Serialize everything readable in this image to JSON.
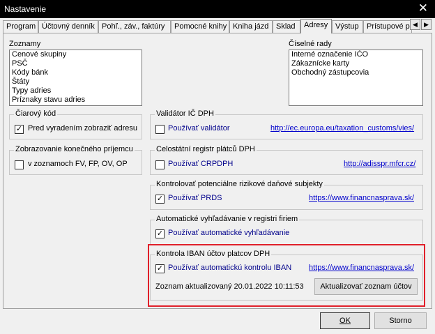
{
  "window": {
    "title": "Nastavenie",
    "close_glyph": "✕"
  },
  "tabs": [
    {
      "label": "Program"
    },
    {
      "label": "Účtovný denník"
    },
    {
      "label": "Pohľ., záv., faktúry"
    },
    {
      "label": "Pomocné knihy"
    },
    {
      "label": "Kniha jázd"
    },
    {
      "label": "Sklad"
    },
    {
      "label": "Adresy",
      "active": true
    },
    {
      "label": "Výstup"
    },
    {
      "label": "Prístupové pr"
    }
  ],
  "tab_arrows": {
    "left": "◀",
    "right": "▶"
  },
  "zoznamy": {
    "label": "Zoznamy",
    "items": [
      "Cenové skupiny",
      "PSČ",
      "Kódy bánk",
      "Štáty",
      "Typy adries",
      "Príznaky stavu adries"
    ]
  },
  "ciselne_rady": {
    "label": "Číselné rady",
    "items": [
      "Interné označenie IČO",
      "Zákaznícke karty",
      "Obchodný zástupcovia"
    ]
  },
  "ciarovy_kod": {
    "title": "Čiarový kód",
    "checkbox_label": "Pred vyradením zobraziť adresu",
    "checked": true
  },
  "konecny_prijemca": {
    "title": "Zobrazovanie konečného príjemcu",
    "checkbox_label": "v zoznamoch FV, FP, OV, OP",
    "checked": false
  },
  "validator": {
    "title": "Validátor IČ DPH",
    "checkbox_label": "Používať validátor",
    "checked": false,
    "link": "http://ec.europa.eu/taxation_customs/vies/"
  },
  "celostatni": {
    "title": "Celostátní registr plátců DPH",
    "checkbox_label": "Používať CRPDPH",
    "checked": false,
    "link": "http://adisspr.mfcr.cz/"
  },
  "prds": {
    "title": "Kontrolovať potenciálne rizikové daňové subjekty",
    "checkbox_label": "Používať PRDS",
    "checked": true,
    "link": "https://www.financnasprava.sk/"
  },
  "auto_search": {
    "title": "Automatické vyhľadávanie v registri firiem",
    "checkbox_label": "Používať automatické vyhľadávanie",
    "checked": true
  },
  "iban": {
    "title": "Kontrola IBAN účtov platcov DPH",
    "checkbox_label": "Používať automatickú kontrolu IBAN",
    "checked": true,
    "link": "https://www.financnasprava.sk/",
    "updated_text": "Zoznam aktualizovaný 20.01.2022 10:11:53",
    "update_button": "Aktualizovať zoznam účtov",
    "highlight_color": "#e0202a"
  },
  "footer": {
    "ok_label": "OK",
    "cancel_label": "Storno"
  }
}
